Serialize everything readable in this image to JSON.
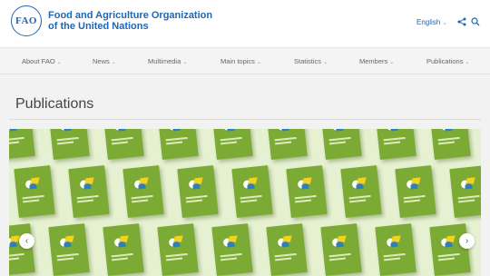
{
  "header": {
    "logo_text": "FAO",
    "org_name_line1": "Food and Agriculture Organization",
    "org_name_line2": "of the United Nations",
    "language": "English",
    "icons": [
      "share-icon",
      "search-icon"
    ]
  },
  "nav": {
    "items": [
      {
        "label": "About FAO"
      },
      {
        "label": "News"
      },
      {
        "label": "Multimedia"
      },
      {
        "label": "Main topics"
      },
      {
        "label": "Statistics"
      },
      {
        "label": "Members"
      },
      {
        "label": "Publications"
      }
    ]
  },
  "main": {
    "title": "Publications"
  },
  "carousel": {
    "prev_icon": "chevron-left-icon",
    "next_icon": "chevron-right-icon"
  },
  "colors": {
    "brand_blue": "#1f66b3",
    "book_green": "#7cab35",
    "banner_bg": "#e6f1d2"
  }
}
